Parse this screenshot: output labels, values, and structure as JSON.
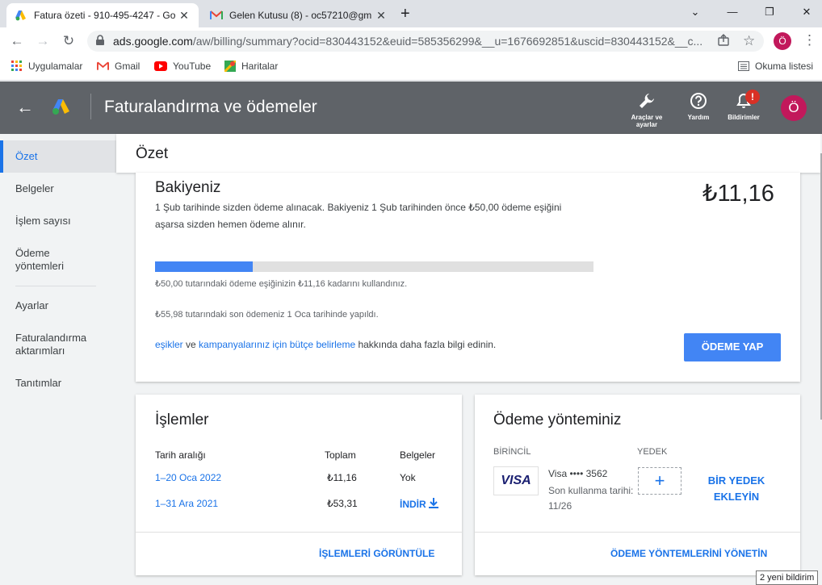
{
  "browser": {
    "tabs": [
      {
        "title": "Fatura özeti - 910-495-4247 - Go"
      },
      {
        "title": "Gelen Kutusu (8) - oc57210@gm"
      }
    ],
    "new_tab": "+",
    "window": {
      "minimize": "⌄",
      "min": "—",
      "restore": "❐",
      "close": "✕"
    },
    "url": {
      "host": "ads.google.com",
      "path": "/aw/billing/summary?ocid=830443152&euid=585356299&__u=1676692851&uscid=830443152&__c..."
    },
    "profile_initial": "Ö",
    "bookmarks": [
      {
        "label": "Uygulamalar",
        "icon": "apps-grid-icon"
      },
      {
        "label": "Gmail",
        "icon": "gmail-icon"
      },
      {
        "label": "YouTube",
        "icon": "youtube-icon"
      },
      {
        "label": "Haritalar",
        "icon": "maps-icon"
      }
    ],
    "reading_list": "Okuma listesi"
  },
  "header": {
    "title": "Faturalandırma ve ödemeler",
    "tools_label": "Araçlar ve ayarlar",
    "help_label": "Yardım",
    "notifications_label": "Bildirimler",
    "notification_badge": "!",
    "avatar_initial": "Ö"
  },
  "sidebar": {
    "items": [
      {
        "label": "Özet",
        "active": true
      },
      {
        "label": "Belgeler"
      },
      {
        "label": "İşlem sayısı"
      },
      {
        "label": "Ödeme yöntemleri"
      },
      {
        "label": "Ayarlar"
      },
      {
        "label": "Faturalandırma aktarımları"
      },
      {
        "label": "Tanıtımlar"
      }
    ]
  },
  "page": {
    "title": "Özet"
  },
  "balance": {
    "title": "Bakiyeniz",
    "amount": "₺11,16",
    "desc_line1": "1 Şub tarihinde sizden ödeme alınacak. Bakiyeniz 1 Şub tarihinden önce ₺50,00 ödeme eşiğini",
    "desc_line2": "aşarsa sizden hemen ödeme alınır.",
    "progress_fraction": 0.2232,
    "progress_text": "₺50,00 tutarındaki ödeme eşiğinizin ₺11,16 kadarını kullandınız.",
    "last_payment": "₺55,98 tutarındaki son ödemeniz 1 Oca tarihinde yapıldı.",
    "info_link1": "eşikler",
    "info_and": " ve ",
    "info_link2": "kampanyalarınız için bütçe belirleme",
    "info_rest": " hakkında daha fazla bilgi edinin.",
    "pay_button": "ÖDEME YAP",
    "colors": {
      "progress_fill": "#4285f4",
      "progress_track": "#e0e0e0"
    }
  },
  "transactions": {
    "title": "İşlemler",
    "headers": {
      "date": "Tarih aralığı",
      "total": "Toplam",
      "docs": "Belgeler"
    },
    "rows": [
      {
        "date": "1–20 Oca 2022",
        "total": "₺11,16",
        "docs": "Yok"
      },
      {
        "date": "1–31 Ara 2021",
        "total": "₺53,31",
        "docs": "İNDİR"
      }
    ],
    "view_link": "İŞLEMLERİ GÖRÜNTÜLE"
  },
  "payment_method": {
    "title": "Ödeme yönteminiz",
    "primary_label": "BİRİNCİL",
    "backup_label": "YEDEK",
    "card_brand": "VISA",
    "card_name": "Visa •••• 3562",
    "expiry_line1": "Son kullanma tarihi:",
    "expiry_line2": "11/26",
    "add_backup_line1": "BİR YEDEK",
    "add_backup_line2": "EKLEYİN",
    "manage_link": "ÖDEME YÖNTEMLERİNİ YÖNETİN"
  },
  "tooltip": "2 yeni bildirim"
}
